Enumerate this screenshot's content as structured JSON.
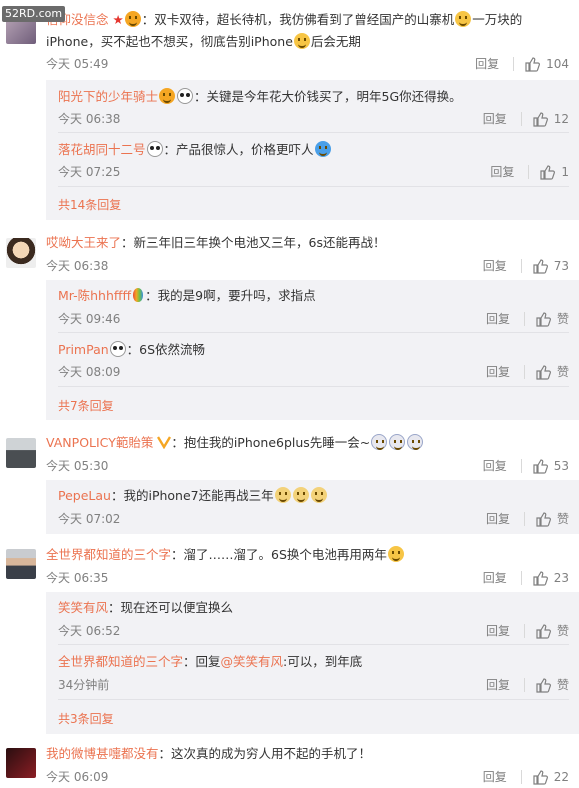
{
  "watermark": "52RD.com",
  "reply_label": "回复",
  "zan_label": "赞",
  "comments": [
    {
      "user": "信仰没信念",
      "text_a": "：双卡双待，超长待机，我仿佛看到了曾经国产的山寨机",
      "text_b": "一万块的iPhone，买不起也不想买，彻底告别iPhone",
      "text_c": "后会无期",
      "time": "今天 05:49",
      "likes": "104",
      "replies": [
        {
          "user": "阳光下的少年骑士",
          "text": "：关键是今年花大价钱买了，明年5G你还得换。",
          "time": "今天 06:38",
          "likes": "12"
        },
        {
          "user": "落花胡同十二号",
          "text": "：产品很惊人，价格更吓人",
          "time": "今天 07:25",
          "likes": "1"
        }
      ],
      "more": "共14条回复"
    },
    {
      "user": "哎呦大王来了",
      "text_a": "：新三年旧三年换个电池又三年，6s还能再战！",
      "time": "今天 06:38",
      "likes": "73",
      "replies": [
        {
          "user": "Mr-陈hhhffff",
          "text": "：我的是9啊，要升吗，求指点",
          "time": "今天 09:46",
          "likes": "赞"
        },
        {
          "user": "PrimPan",
          "text": "：6S依然流畅",
          "time": "今天 08:09",
          "likes": "赞"
        }
      ],
      "more": "共7条回复"
    },
    {
      "user": "VANPOLICY範貽策",
      "text_a": "：抱住我的iPhone6plus先睡一会~",
      "time": "今天 05:30",
      "likes": "53",
      "replies": [
        {
          "user": "PepeLau",
          "text": "：我的iPhone7还能再战三年",
          "time": "今天 07:02",
          "likes": "赞"
        }
      ]
    },
    {
      "user": "全世界都知道的三个字",
      "text_a": "：溜了……溜了。6S换个电池再用两年",
      "time": "今天 06:35",
      "likes": "23",
      "replies": [
        {
          "user": "笑笑有风",
          "text": "：现在还可以便宜换么",
          "time": "今天 06:52",
          "likes": "赞"
        },
        {
          "user": "全世界都知道的三个字",
          "text_pre": "：回复",
          "mention": "@笑笑有风",
          "text": ":可以，到年底",
          "time": "34分钟前",
          "likes": "赞"
        }
      ],
      "more": "共3条回复"
    },
    {
      "user": "我的微博甚嚏都没有",
      "text_a": "：这次真的成为穷人用不起的手机了！",
      "time": "今天 06:09",
      "likes": "22"
    }
  ],
  "colors": {
    "accent": "#eb7350",
    "meta": "#808080",
    "reply_bg": "#f2f2f5"
  }
}
